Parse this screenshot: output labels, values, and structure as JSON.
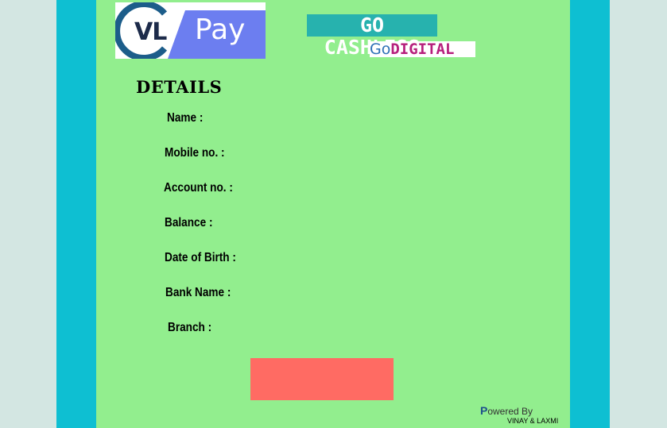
{
  "logo": {
    "brand_left": "VL",
    "brand_right": "Pay",
    "circle_color": "#1c5d8a",
    "pay_color": "#6c7ef0"
  },
  "banners": {
    "cashless": "GO CASHLESS",
    "digital_go": "Go",
    "digital_word": "DIGITAL"
  },
  "details": {
    "title": "DETAILS",
    "fields": [
      {
        "label": "Name   :"
      },
      {
        "label": "Mobile no.  :"
      },
      {
        "label": "Account no. :"
      },
      {
        "label": "Balance   :"
      },
      {
        "label": "Date of Birth :"
      },
      {
        "label": "Bank Name :"
      },
      {
        "label": "Branch :"
      }
    ]
  },
  "footer": {
    "powered_first": "P",
    "powered_rest": "owered By",
    "authors": "VINAY & LAXMI"
  },
  "colors": {
    "card": "#92ee8e",
    "side": "#0ebfd2",
    "button": "#ff6b63"
  }
}
